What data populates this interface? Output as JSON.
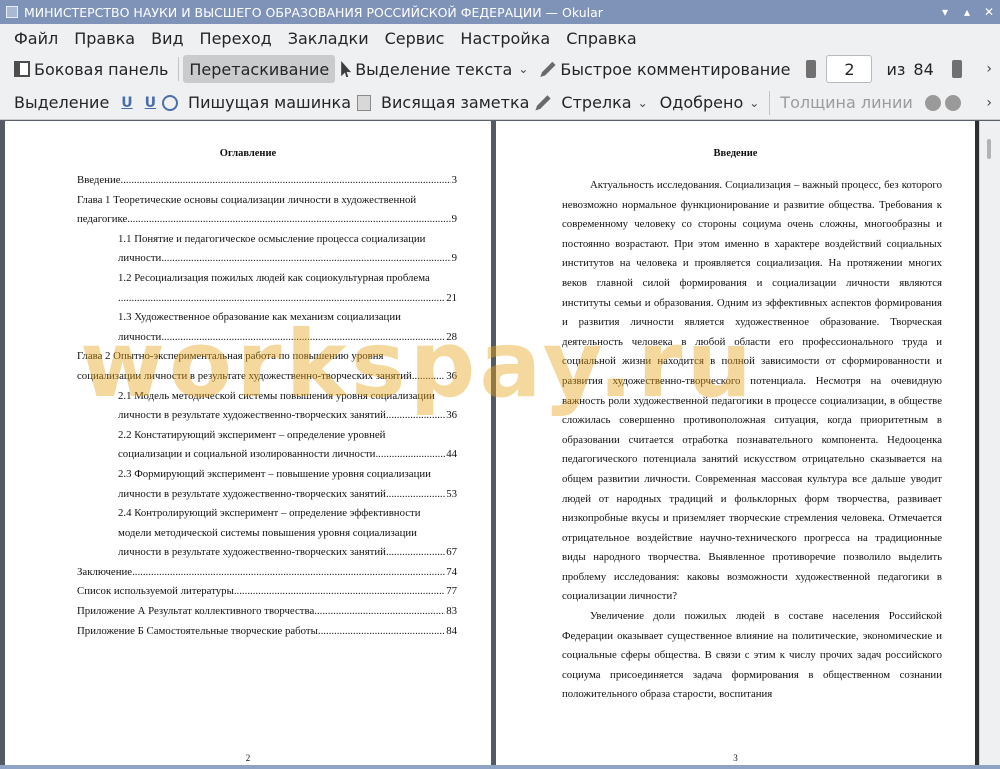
{
  "window": {
    "title": "МИНИСТЕРСТВО НАУКИ И ВЫСШЕГО ОБРАЗОВАНИЯ РОССИЙСКОЙ ФЕДЕРАЦИИ — Okular"
  },
  "menu": [
    "Файл",
    "Правка",
    "Вид",
    "Переход",
    "Закладки",
    "Сервис",
    "Настройка",
    "Справка"
  ],
  "toolbar1": {
    "sidebar": "Боковая панель",
    "drag": "Перетаскивание",
    "text_select": "Выделение текста",
    "quick_comment": "Быстрое комментирование",
    "page_current": "2",
    "page_of": "из",
    "page_total": "84"
  },
  "toolbar2": {
    "selection": "Выделение",
    "typewriter": "Пишущая машинка",
    "hanging_note": "Висящая заметка",
    "arrow": "Стрелка",
    "approved": "Одобрено",
    "line_width": "Толщина линии"
  },
  "left_page": {
    "heading": "Оглавление",
    "page_number": "2",
    "toc": [
      {
        "text": "Введение",
        "page": "3",
        "indent": false
      },
      {
        "text": "Глава 1 Теоретические основы социализации личности в художественной",
        "cont": "педагогике",
        "page": "9",
        "indent": false
      },
      {
        "text": "1.1 Понятие и педагогическое осмысление процесса социализации",
        "cont": "личности",
        "page": "9",
        "indent": true
      },
      {
        "text": "1.2 Ресоциализация пожилых людей как социокультурная проблема",
        "cont": "",
        "page": "21",
        "indent": true
      },
      {
        "text": "1.3 Художественное образование как механизм социализации",
        "cont": "личности",
        "page": "28",
        "indent": true
      },
      {
        "text": "Глава 2 Опытно-экспериментальная работа по повышению уровня",
        "cont": "социализации личности в результате художественно-творческих занятий",
        "page": "36",
        "indent": false
      },
      {
        "text": "2.1 Модель методической системы повышения уровня социализации",
        "cont": "личности в результате художественно-творческих занятий",
        "page": "36",
        "indent": true
      },
      {
        "text": "2.2 Констатирующий эксперимент – определение уровней",
        "cont": "социализации и социальной изолированности личности",
        "page": "44",
        "indent": true
      },
      {
        "text": "2.3 Формирующий эксперимент – повышение уровня социализации",
        "cont": "личности в результате художественно-творческих занятий",
        "page": "53",
        "indent": true
      },
      {
        "text": "2.4 Контролирующий эксперимент – определение эффективности",
        "mid": "модели методической системы повышения уровня социализации",
        "cont": "личности в результате художественно-творческих занятий",
        "page": "67",
        "indent": true
      },
      {
        "text": "Заключение",
        "page": "74",
        "indent": false
      },
      {
        "text": "Список используемой литературы",
        "page": "77",
        "indent": false
      },
      {
        "text": "Приложение А Результат коллективного творчества",
        "page": "83",
        "indent": false
      },
      {
        "text": "Приложение Б Самостоятельные творческие работы",
        "page": "84",
        "indent": false
      }
    ]
  },
  "right_page": {
    "heading": "Введение",
    "page_number": "3",
    "paragraphs": [
      "Актуальность исследования. Социализация – важный процесс, без которого невозможно нормальное функционирование и развитие общества. Требования к современному человеку со стороны социума очень сложны, многообразны и постоянно возрастают. При этом именно в характере воздействий социальных институтов на человека и проявляется социализация. На протяжении многих веков главной силой формирования и социализации личности являются институты семьи и образования. Одним из эффективных аспектов формирования и развития личности является художественное образование. Творческая деятельность человека в любой области его профессионального труда и социальной жизни находится в полной зависимости от сформированности и развития художественно-творческого потенциала. Несмотря на очевидную важность роли художественной педагогики в процессе социализации, в обществе сложилась совершенно противоположная ситуация, когда приоритетным в образовании считается отработка познавательного компонента. Недооценка педагогического потенциала занятий искусством отрицательно сказывается на общем развитии личности. Современная массовая культура все дальше уводит людей от народных традиций и фольклорных форм творчества, развивает низкопробные вкусы и приземляет творческие стремления человека. Отмечается отрицательное воздействие научно-технического прогресса на традиционные виды народного творчества. Выявленное противоречие позволило выделить проблему исследования: каковы возможности художественной педагогики в социализации личности?",
      "Увеличение доли пожилых людей в составе населения Российской Федерации оказывает существенное влияние на политические, экономические и социальные сферы общества. В связи с этим к числу прочих задач российского социума присоединяется задача формирования в общественном сознании положительного образа старости, воспитания"
    ]
  },
  "watermark": "workspay.ru",
  "colors": {
    "titlebar": "#7f93b8",
    "toolbar": "#eff0f1",
    "watermark": "#e8a317"
  }
}
